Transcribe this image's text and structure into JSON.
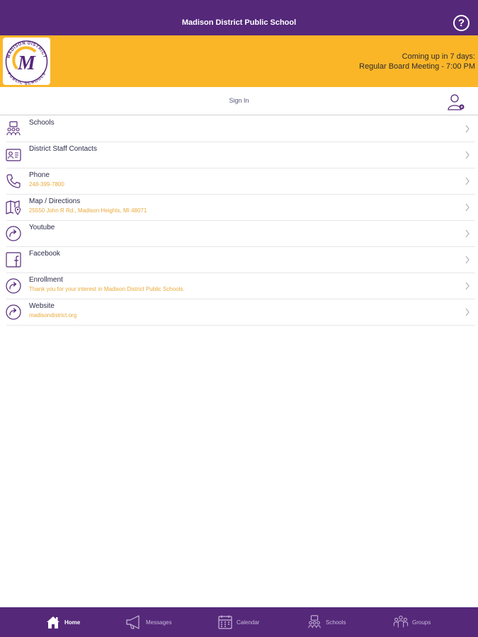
{
  "header": {
    "title": "Madison District Public School",
    "help_label": "?"
  },
  "banner": {
    "logo_text_top": "MADISON DISTRICT",
    "logo_text_bottom": "PUBLIC SCHOOLS",
    "logo_letter": "M",
    "upcoming_label": "Coming up in 7 days:",
    "upcoming_event": "Regular Board Meeting - 7:00 PM"
  },
  "signin": {
    "label": "Sign In"
  },
  "menu": {
    "items": [
      {
        "title": "Schools",
        "subtitle": "",
        "icon": "schools-icon"
      },
      {
        "title": "District Staff Contacts",
        "subtitle": "",
        "icon": "contact-card-icon"
      },
      {
        "title": "Phone",
        "subtitle": "248-399-7800",
        "icon": "phone-icon"
      },
      {
        "title": "Map / Directions",
        "subtitle": "25550 John R Rd., Madison Heights, MI 48071",
        "icon": "map-icon"
      },
      {
        "title": "Youtube",
        "subtitle": "",
        "icon": "share-arrow-icon"
      },
      {
        "title": "Facebook",
        "subtitle": "",
        "icon": "facebook-icon"
      },
      {
        "title": "Enrollment",
        "subtitle": "Thank you for your interest in Madison District Public Schools.",
        "icon": "share-arrow-icon"
      },
      {
        "title": "Website",
        "subtitle": "madisondistrict.org",
        "icon": "share-arrow-icon"
      }
    ]
  },
  "tabs": [
    {
      "label": "Home",
      "icon": "home-icon",
      "active": true
    },
    {
      "label": "Messages",
      "icon": "megaphone-icon",
      "active": false
    },
    {
      "label": "Calendar",
      "icon": "calendar-icon",
      "active": false
    },
    {
      "label": "Schools",
      "icon": "schools-icon",
      "active": false
    },
    {
      "label": "Groups",
      "icon": "groups-icon",
      "active": false
    }
  ],
  "colors": {
    "primary": "#55287a",
    "accent": "#fbb628",
    "subtitle": "#e9a93a"
  }
}
